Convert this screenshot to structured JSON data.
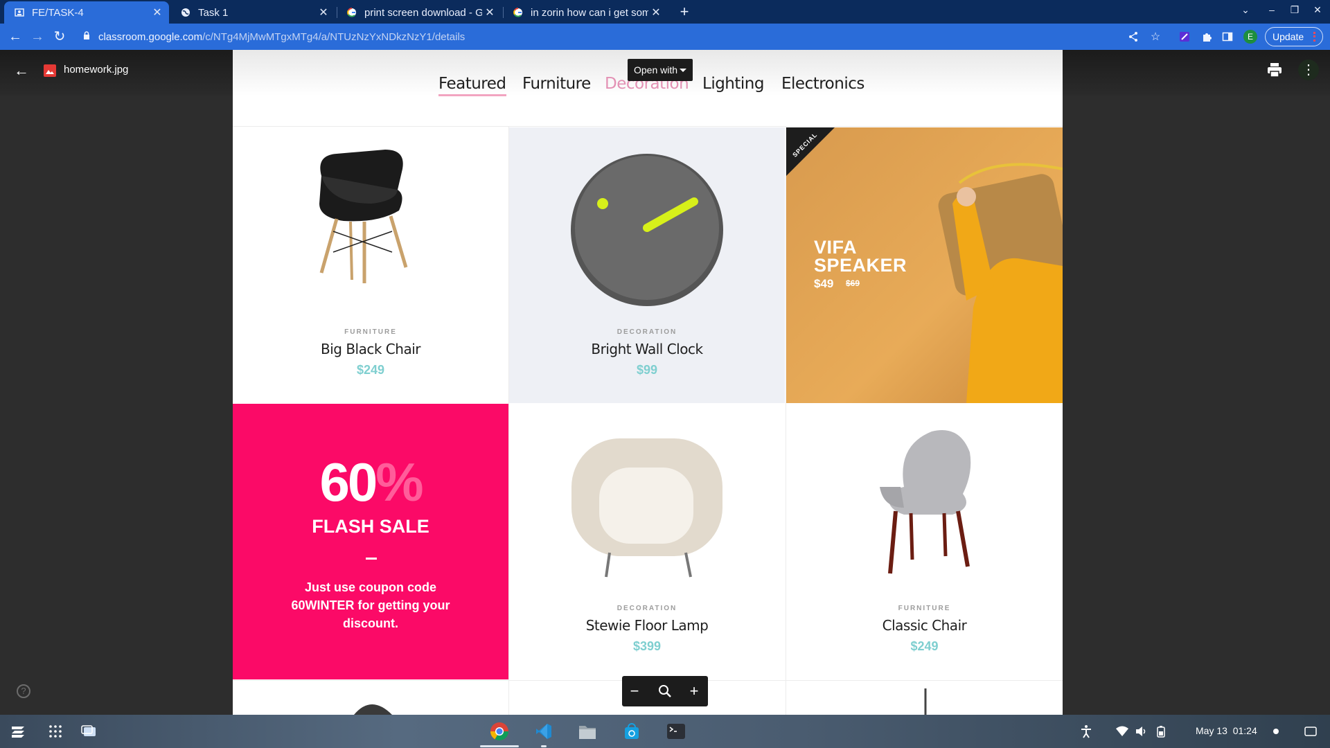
{
  "browser": {
    "tabs": [
      {
        "title": "FE/TASK-4",
        "active": true,
        "icon": "classroom-icon"
      },
      {
        "title": "Task 1",
        "active": false,
        "icon": "globe-icon"
      },
      {
        "title": "print screen download - Go",
        "active": false,
        "icon": "google-icon"
      },
      {
        "title": "in zorin how can i get some",
        "active": false,
        "icon": "google-icon"
      }
    ],
    "new_tab": "+",
    "url_host": "classroom.google.com",
    "url_path": "/c/NTg4MjMwMTgxMTg4/a/NTUzNzYxNDkzNzY1/details",
    "update_label": "Update",
    "profile_initial": "E"
  },
  "viewer": {
    "file_name": "homework.jpg",
    "open_with_label": "Open with"
  },
  "shop": {
    "categories": [
      "Featured",
      "Furniture",
      "Decoration",
      "Lighting",
      "Electronics"
    ],
    "products": [
      {
        "category": "FURNITURE",
        "name": "Big Black Chair",
        "price": "$249"
      },
      {
        "category": "DECORATION",
        "name": "Bright Wall Clock",
        "price": "$99"
      },
      {
        "category": "DECORATION",
        "name": "Stewie Floor Lamp",
        "price": "$399"
      },
      {
        "category": "FURNITURE",
        "name": "Classic Chair",
        "price": "$249"
      }
    ],
    "speaker": {
      "ribbon": "SPECIAL",
      "title_line1": "VIFA",
      "title_line2": "SPEAKER",
      "price": "$49",
      "old_price": "$69"
    },
    "flash": {
      "percent_num": "60",
      "percent_sym": "%",
      "title": "FLASH SALE",
      "text": "Just use coupon code 60WINTER for getting your discount."
    }
  },
  "shelf": {
    "date": "May 13",
    "time": "01:24"
  },
  "colors": {
    "tabstrip": "#0b2b5c",
    "toolbar": "#2a6cd9",
    "flash_bg": "#fb0a67",
    "price": "#7fcfd0"
  }
}
